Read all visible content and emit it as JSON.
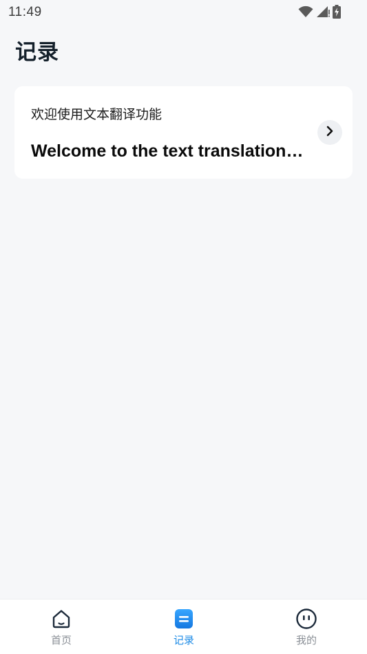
{
  "status_bar": {
    "time": "11:49",
    "icons": [
      "wifi-icon",
      "cellular-signal-icon",
      "battery-charging-icon"
    ]
  },
  "page": {
    "title": "记录"
  },
  "records": [
    {
      "source_text": "欢迎使用文本翻译功能",
      "translated_text": "Welcome to the text translation function",
      "open_icon": "chevron-right-icon"
    }
  ],
  "bottom_nav": {
    "items": [
      {
        "label": "首页",
        "icon": "home-icon",
        "active": false
      },
      {
        "label": "记录",
        "icon": "records-icon",
        "active": true
      },
      {
        "label": "我的",
        "icon": "profile-face-icon",
        "active": false
      }
    ]
  },
  "colors": {
    "background": "#f6f7f9",
    "card": "#ffffff",
    "title": "#14202b",
    "accent": "#1d8be6",
    "nav_inactive": "#8a8f96"
  }
}
